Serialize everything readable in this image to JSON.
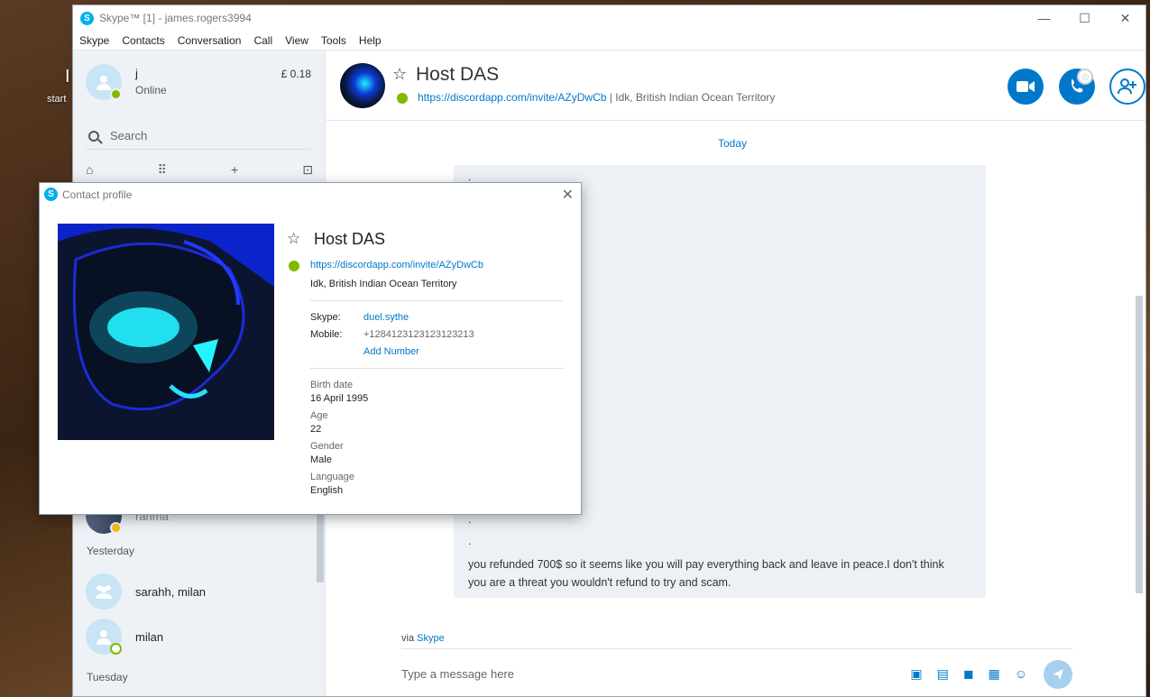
{
  "desktop": {
    "icon_label": "start",
    "icon_letter": "I"
  },
  "window": {
    "title": "Skype™ [1] - james.rogers3994",
    "controls": {
      "minimize": "—",
      "maximize": "☐",
      "close": "✕"
    }
  },
  "menu": [
    "Skype",
    "Contacts",
    "Conversation",
    "Call",
    "View",
    "Tools",
    "Help"
  ],
  "me": {
    "name": "j",
    "status": "Online",
    "credit": "£ 0.18"
  },
  "search": {
    "placeholder": "Search"
  },
  "sidebar": {
    "tools": {
      "home": "⌂",
      "dialpad": "⠿",
      "add": "+",
      "bot": "⊡"
    },
    "partial_contact": "rahma",
    "sections": [
      "Yesterday",
      "Tuesday"
    ],
    "contacts": [
      {
        "name": "sarahh, milan"
      },
      {
        "name": "milan"
      }
    ]
  },
  "chat": {
    "contact_name": "Host DAS",
    "link": "https://discordapp.com/invite/AZyDwCb",
    "separator": "|",
    "location": "Idk, British Indian Ocean Territory",
    "date_label": "Today",
    "dots": [
      ".",
      ".",
      "."
    ],
    "message": "you refunded 700$ so it seems like you will pay everything back and leave in peace.I don't think you are a threat you wouldn't refund to try and scam.",
    "via_prefix": "via",
    "via_link": "Skype",
    "compose_placeholder": "Type a message here"
  },
  "profile": {
    "title": "Contact profile",
    "close": "✕",
    "name": "Host DAS",
    "link": "https://discordapp.com/invite/AZyDwCb",
    "location": "Idk, British Indian Ocean Territory",
    "skype_label": "Skype:",
    "skype_value": "duel.sythe",
    "mobile_label": "Mobile:",
    "mobile_value": "+1284123123123123213",
    "add_number": "Add Number",
    "birth_label": "Birth date",
    "birth_value": "16 April 1995",
    "age_label": "Age",
    "age_value": "22",
    "gender_label": "Gender",
    "gender_value": "Male",
    "language_label": "Language",
    "language_value": "English"
  },
  "icons": {
    "video": "video-call-icon",
    "call": "call-icon",
    "add_people": "add-people-icon",
    "send": "send-icon"
  }
}
